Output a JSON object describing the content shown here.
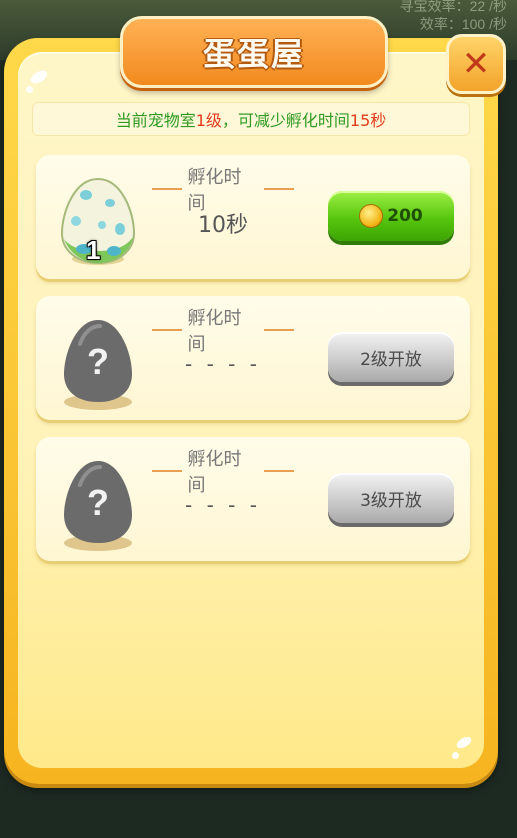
{
  "background": {
    "stat_line_1": "寻宝效率：22 /秒",
    "stat_line_2": "效率：100 /秒"
  },
  "dialog": {
    "title": "蛋蛋屋",
    "close_icon": "close-icon"
  },
  "info": {
    "prefix": "当前宠物室",
    "level": "1级",
    "middle": "，可减少孵化时间",
    "reduce_time": "15秒"
  },
  "slots": [
    {
      "egg": "spotted-egg-icon",
      "count": "1",
      "time_label": "孵化时间",
      "time_value": "10秒",
      "action": {
        "type": "coin",
        "icon": "gold-coin-icon",
        "label": "200"
      }
    },
    {
      "egg": "locked-egg-icon",
      "time_label": "孵化时间",
      "time_value": "- - - -",
      "action": {
        "type": "locked",
        "label": "2级开放"
      }
    },
    {
      "egg": "locked-egg-icon",
      "time_label": "孵化时间",
      "time_value": "- - - -",
      "action": {
        "type": "locked",
        "label": "3级开放"
      }
    }
  ],
  "colors": {
    "panel": "#f6b420",
    "inner": "#fff3b9",
    "title_banner": "#f28a1e",
    "info_green": "#2f9a23",
    "info_red": "#e23a1d",
    "buy_button": "#57c60e",
    "locked_button": "#c8c8c8"
  }
}
